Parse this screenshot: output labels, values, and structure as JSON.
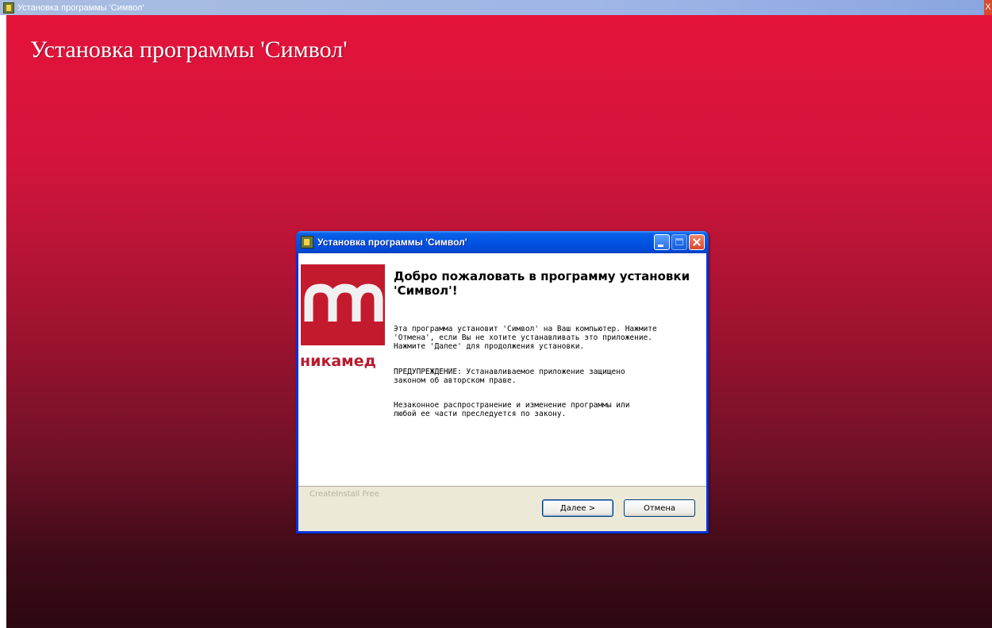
{
  "outer_window": {
    "title": "Установка программы 'Символ'",
    "close_label": "X"
  },
  "background": {
    "title": "Установка программы 'Символ'"
  },
  "dialog": {
    "title": "Установка программы 'Символ'",
    "logo_text": "никамед",
    "heading": "Добро пожаловать в программу установки 'Символ'!",
    "paragraph1": "Эта программа установит 'Символ' на Ваш компьютер. Нажмите\n'Отмена', если Вы не хотите устанавливать это приложение.\nНажмите 'Далее' для продолжения установки.",
    "paragraph2": "ПРЕДУПРЕЖДЕНИЕ: Устанавливаемое приложение защищено\nзаконом об авторском праве.",
    "paragraph3": "Незаконное распространение и изменение программы или\nлюбой ее части преследуется по закону.",
    "footer_brand": "CreateInstall Free",
    "next_button": "Далее >",
    "cancel_button": "Отмена"
  },
  "colors": {
    "titlebar_blue": "#0054e3",
    "background_top": "#e5133a",
    "background_bottom": "#2c0810",
    "logo_red": "#c41a2e"
  }
}
